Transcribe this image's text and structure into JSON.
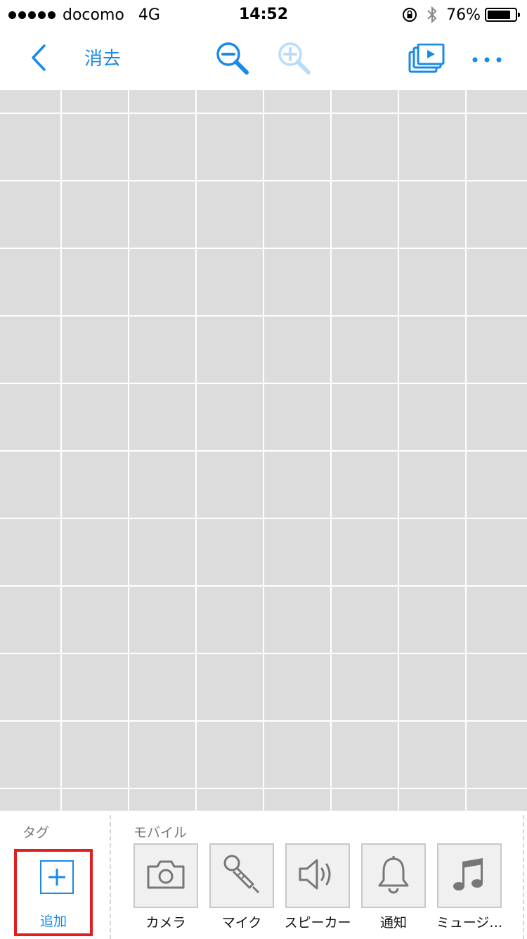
{
  "status_bar": {
    "carrier": "docomo",
    "network": "4G",
    "time": "14:52",
    "battery": "76%",
    "battery_level": 0.76,
    "icons": [
      "signal-dots",
      "orientation-lock-icon",
      "bluetooth-icon",
      "battery-icon"
    ]
  },
  "nav": {
    "back_icon": "chevron-left-icon",
    "clear_label": "消去",
    "zoom_out_icon": "zoom-out-icon",
    "zoom_in_icon": "zoom-in-icon",
    "slides_icon": "slideshow-icon",
    "more_icon": "more-icon"
  },
  "colors": {
    "accent": "#1a8ae8",
    "grid_bg": "#dcdcdc",
    "highlight": "#e02020"
  },
  "bottom": {
    "tag_label": "タグ",
    "mobile_label": "モバイル",
    "add_label": "追加",
    "tiles": [
      {
        "label": "カメラ",
        "icon": "camera-icon"
      },
      {
        "label": "マイク",
        "icon": "microphone-icon"
      },
      {
        "label": "スピーカー",
        "icon": "speaker-icon"
      },
      {
        "label": "通知",
        "icon": "bell-icon"
      },
      {
        "label": "ミュージ…",
        "icon": "music-note-icon"
      }
    ]
  }
}
